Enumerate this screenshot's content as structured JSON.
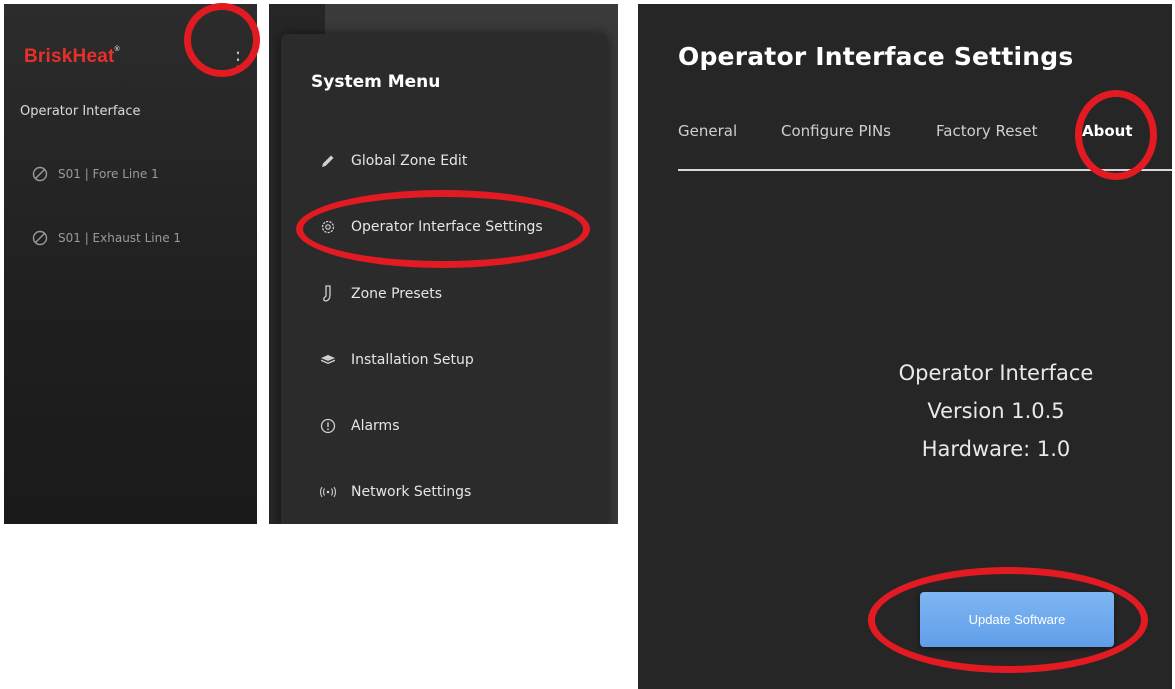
{
  "panel1": {
    "brand": "BriskHeat",
    "brand_mark": "®",
    "subtitle": "Operator Interface",
    "zones": [
      {
        "label": "S01 | Fore Line 1"
      },
      {
        "label": "S01 | Exhaust Line 1"
      }
    ]
  },
  "panel2": {
    "title": "System Menu",
    "items": [
      {
        "label": "Global Zone Edit",
        "icon": "pencil-icon"
      },
      {
        "label": "Operator Interface Settings",
        "icon": "gear-icon"
      },
      {
        "label": "Zone Presets",
        "icon": "sock-icon"
      },
      {
        "label": "Installation Setup",
        "icon": "box-icon"
      },
      {
        "label": "Alarms",
        "icon": "alert-icon"
      },
      {
        "label": "Network Settings",
        "icon": "wireless-icon"
      }
    ]
  },
  "panel3": {
    "title": "Operator Interface Settings",
    "tabs": [
      {
        "label": "General"
      },
      {
        "label": "Configure PINs"
      },
      {
        "label": "Factory Reset"
      },
      {
        "label": "About"
      }
    ],
    "active_tab": "About",
    "about": {
      "line1": "Operator Interface",
      "line2": "Version 1.0.5",
      "line3": "Hardware: 1.0"
    },
    "update_button": "Update Software"
  },
  "colors": {
    "brand_red": "#e8302a",
    "highlight_ring": "#e21a22",
    "button_blue": "#6aa6ec",
    "panel_bg": "#262626"
  }
}
